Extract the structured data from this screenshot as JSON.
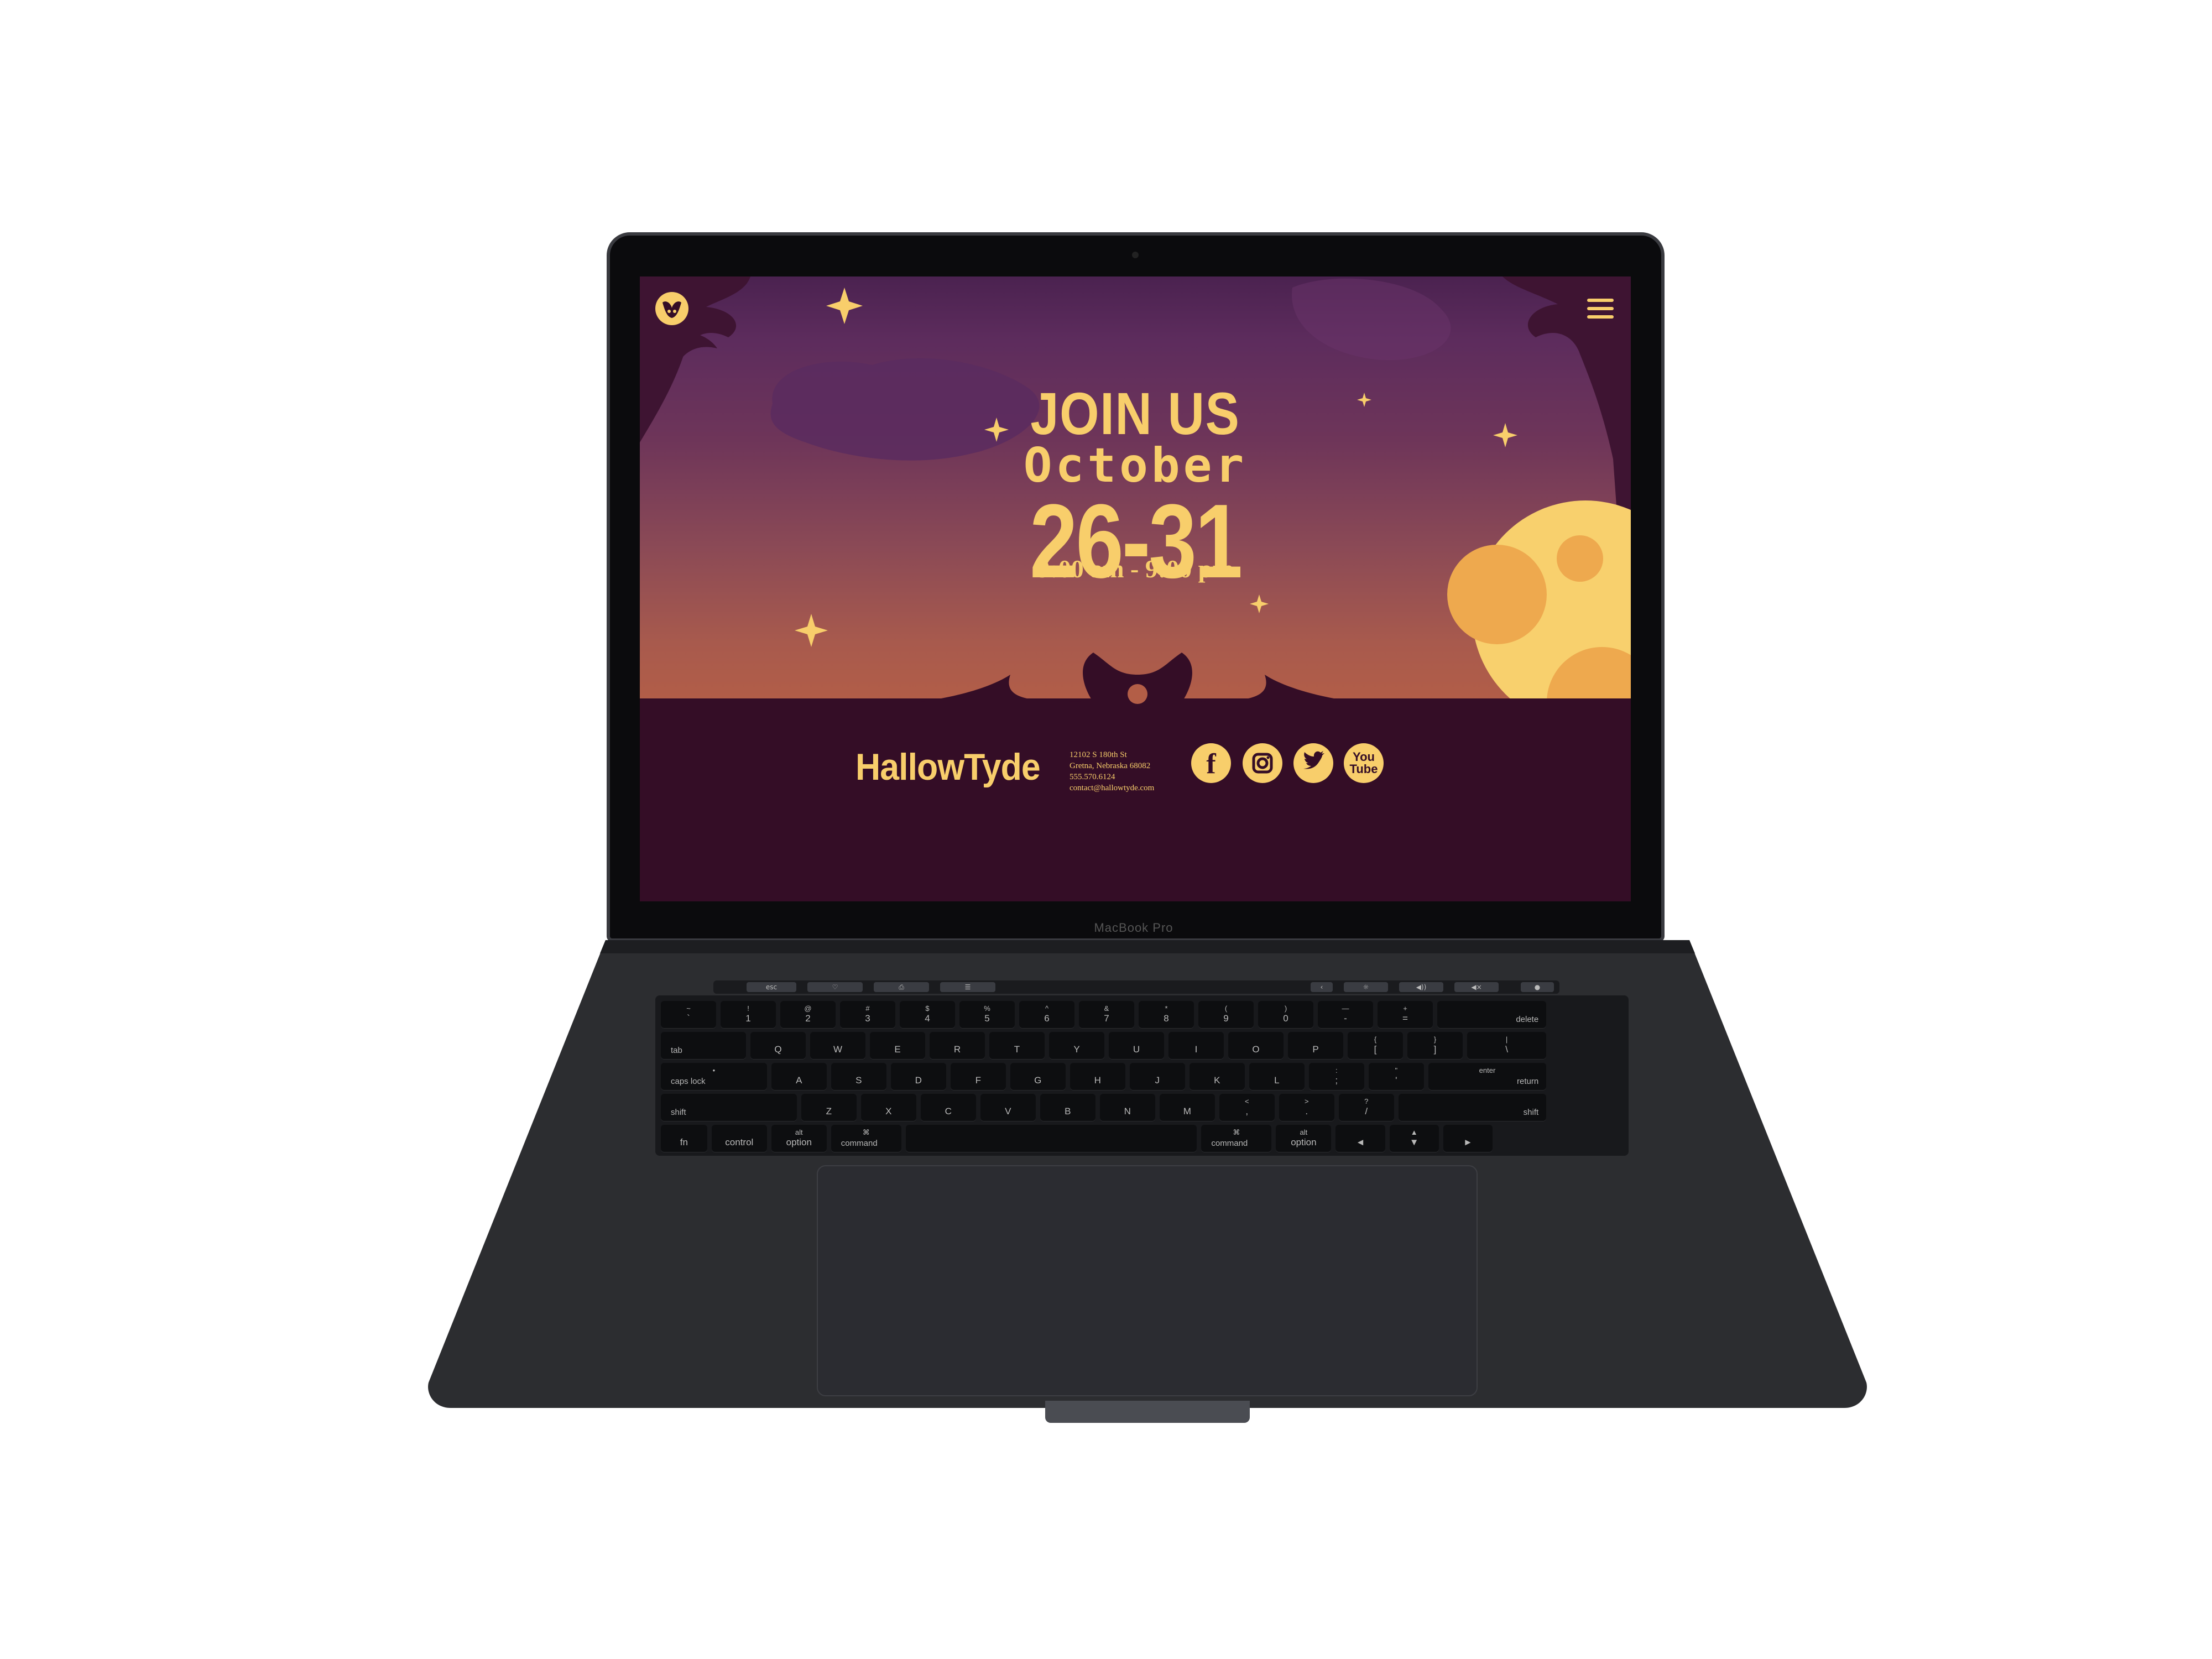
{
  "device": {
    "brand_label": "MacBook Pro"
  },
  "site": {
    "hero": {
      "title": "JOIN US",
      "month": "October",
      "dates": "26-31",
      "hours": "9:00 am - 9:00 pm"
    },
    "footer": {
      "logo_text": "HallowTyde",
      "address": [
        "12102 S 180th St",
        "Gretna, Nebraska 68082",
        "555.570.6124",
        "contact@hallowtyde.com"
      ],
      "social": [
        {
          "icon": "facebook-icon",
          "label": "f"
        },
        {
          "icon": "instagram-icon",
          "label": ""
        },
        {
          "icon": "twitter-icon",
          "label": ""
        },
        {
          "icon": "youtube-icon",
          "label_top": "You",
          "label_bottom": "Tube"
        }
      ]
    },
    "colors": {
      "accent": "#f8ce6b",
      "ground": "#340d26",
      "sky_top": "#4b2250",
      "sky_bottom": "#b35e47",
      "moon": "#f8d06d",
      "moon_craters": "#eea94e"
    }
  },
  "keyboard": {
    "rows": [
      [
        {
          "t": "~",
          "m": "`"
        },
        {
          "t": "!",
          "m": "1"
        },
        {
          "t": "@",
          "m": "2"
        },
        {
          "t": "#",
          "m": "3"
        },
        {
          "t": "$",
          "m": "4"
        },
        {
          "t": "%",
          "m": "5"
        },
        {
          "t": "^",
          "m": "6"
        },
        {
          "t": "&",
          "m": "7"
        },
        {
          "t": "*",
          "m": "8"
        },
        {
          "t": "(",
          "m": "9"
        },
        {
          "t": ")",
          "m": "0"
        },
        {
          "t": "—",
          "m": "-"
        },
        {
          "t": "+",
          "m": "="
        },
        {
          "t": "",
          "m": "delete"
        }
      ],
      [
        {
          "t": "",
          "m": "tab"
        },
        {
          "t": "",
          "m": "Q"
        },
        {
          "t": "",
          "m": "W"
        },
        {
          "t": "",
          "m": "E"
        },
        {
          "t": "",
          "m": "R"
        },
        {
          "t": "",
          "m": "T"
        },
        {
          "t": "",
          "m": "Y"
        },
        {
          "t": "",
          "m": "U"
        },
        {
          "t": "",
          "m": "I"
        },
        {
          "t": "",
          "m": "O"
        },
        {
          "t": "",
          "m": "P"
        },
        {
          "t": "{",
          "m": "["
        },
        {
          "t": "}",
          "m": "]"
        },
        {
          "t": "|",
          "m": "\\"
        }
      ],
      [
        {
          "t": "•",
          "m": "caps lock"
        },
        {
          "t": "",
          "m": "A"
        },
        {
          "t": "",
          "m": "S"
        },
        {
          "t": "",
          "m": "D"
        },
        {
          "t": "",
          "m": "F"
        },
        {
          "t": "",
          "m": "G"
        },
        {
          "t": "",
          "m": "H"
        },
        {
          "t": "",
          "m": "J"
        },
        {
          "t": "",
          "m": "K"
        },
        {
          "t": "",
          "m": "L"
        },
        {
          "t": ":",
          "m": ";"
        },
        {
          "t": "\"",
          "m": "'"
        },
        {
          "t": "enter",
          "m": "return"
        }
      ],
      [
        {
          "t": "",
          "m": "shift"
        },
        {
          "t": "",
          "m": "Z"
        },
        {
          "t": "",
          "m": "X"
        },
        {
          "t": "",
          "m": "C"
        },
        {
          "t": "",
          "m": "V"
        },
        {
          "t": "",
          "m": "B"
        },
        {
          "t": "",
          "m": "N"
        },
        {
          "t": "",
          "m": "M"
        },
        {
          "t": "<",
          "m": ","
        },
        {
          "t": ">",
          "m": "."
        },
        {
          "t": "?",
          "m": "/"
        },
        {
          "t": "",
          "m": "shift"
        }
      ],
      [
        {
          "t": "",
          "m": "fn"
        },
        {
          "t": "",
          "m": "control"
        },
        {
          "t": "alt",
          "m": "option"
        },
        {
          "t": "⌘",
          "m": "command"
        },
        {
          "t": "",
          "m": ""
        },
        {
          "t": "⌘",
          "m": "command"
        },
        {
          "t": "alt",
          "m": "option"
        },
        {
          "t": "",
          "m": "◄"
        },
        {
          "t": "▲",
          "m": "▼"
        },
        {
          "t": "",
          "m": "►"
        }
      ]
    ],
    "touchbar": [
      "esc",
      "♡",
      "⎙",
      "☰",
      "‹",
      "☼",
      "◀))",
      "◀×",
      "●"
    ]
  }
}
